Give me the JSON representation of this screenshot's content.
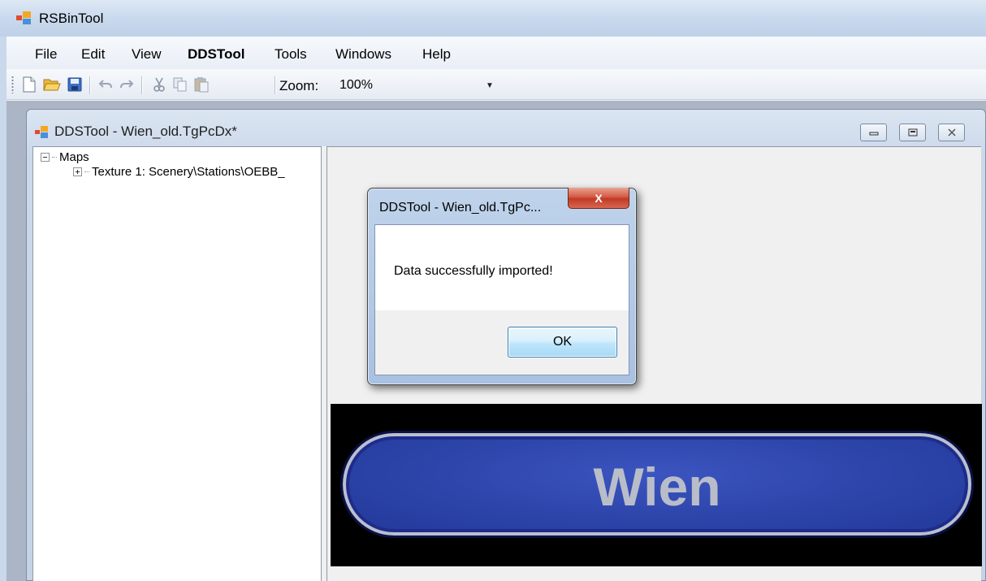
{
  "app": {
    "title": "RSBinTool"
  },
  "menu": {
    "items": [
      "File",
      "Edit",
      "View",
      "DDSTool",
      "Tools",
      "Windows",
      "Help"
    ]
  },
  "toolbar": {
    "icons": [
      "new-file-icon",
      "open-folder-icon",
      "save-icon",
      "undo-icon",
      "redo-icon",
      "cut-icon",
      "copy-icon",
      "paste-icon"
    ],
    "zoom_label": "Zoom:",
    "zoom_value": "100%"
  },
  "child_window": {
    "title": "DDSTool - Wien_old.TgPcDx*"
  },
  "tree": {
    "root": "Maps",
    "child": "Texture 1: Scenery\\Stations\\OEBB_"
  },
  "texture": {
    "text": "Wien"
  },
  "dialog": {
    "title": "DDSTool - Wien_old.TgPc...",
    "close_label": "X",
    "message": "Data successfully imported!",
    "ok_label": "OK"
  },
  "colors": {
    "accent_close": "#c03b25",
    "sign_blue": "#2c44a8"
  }
}
